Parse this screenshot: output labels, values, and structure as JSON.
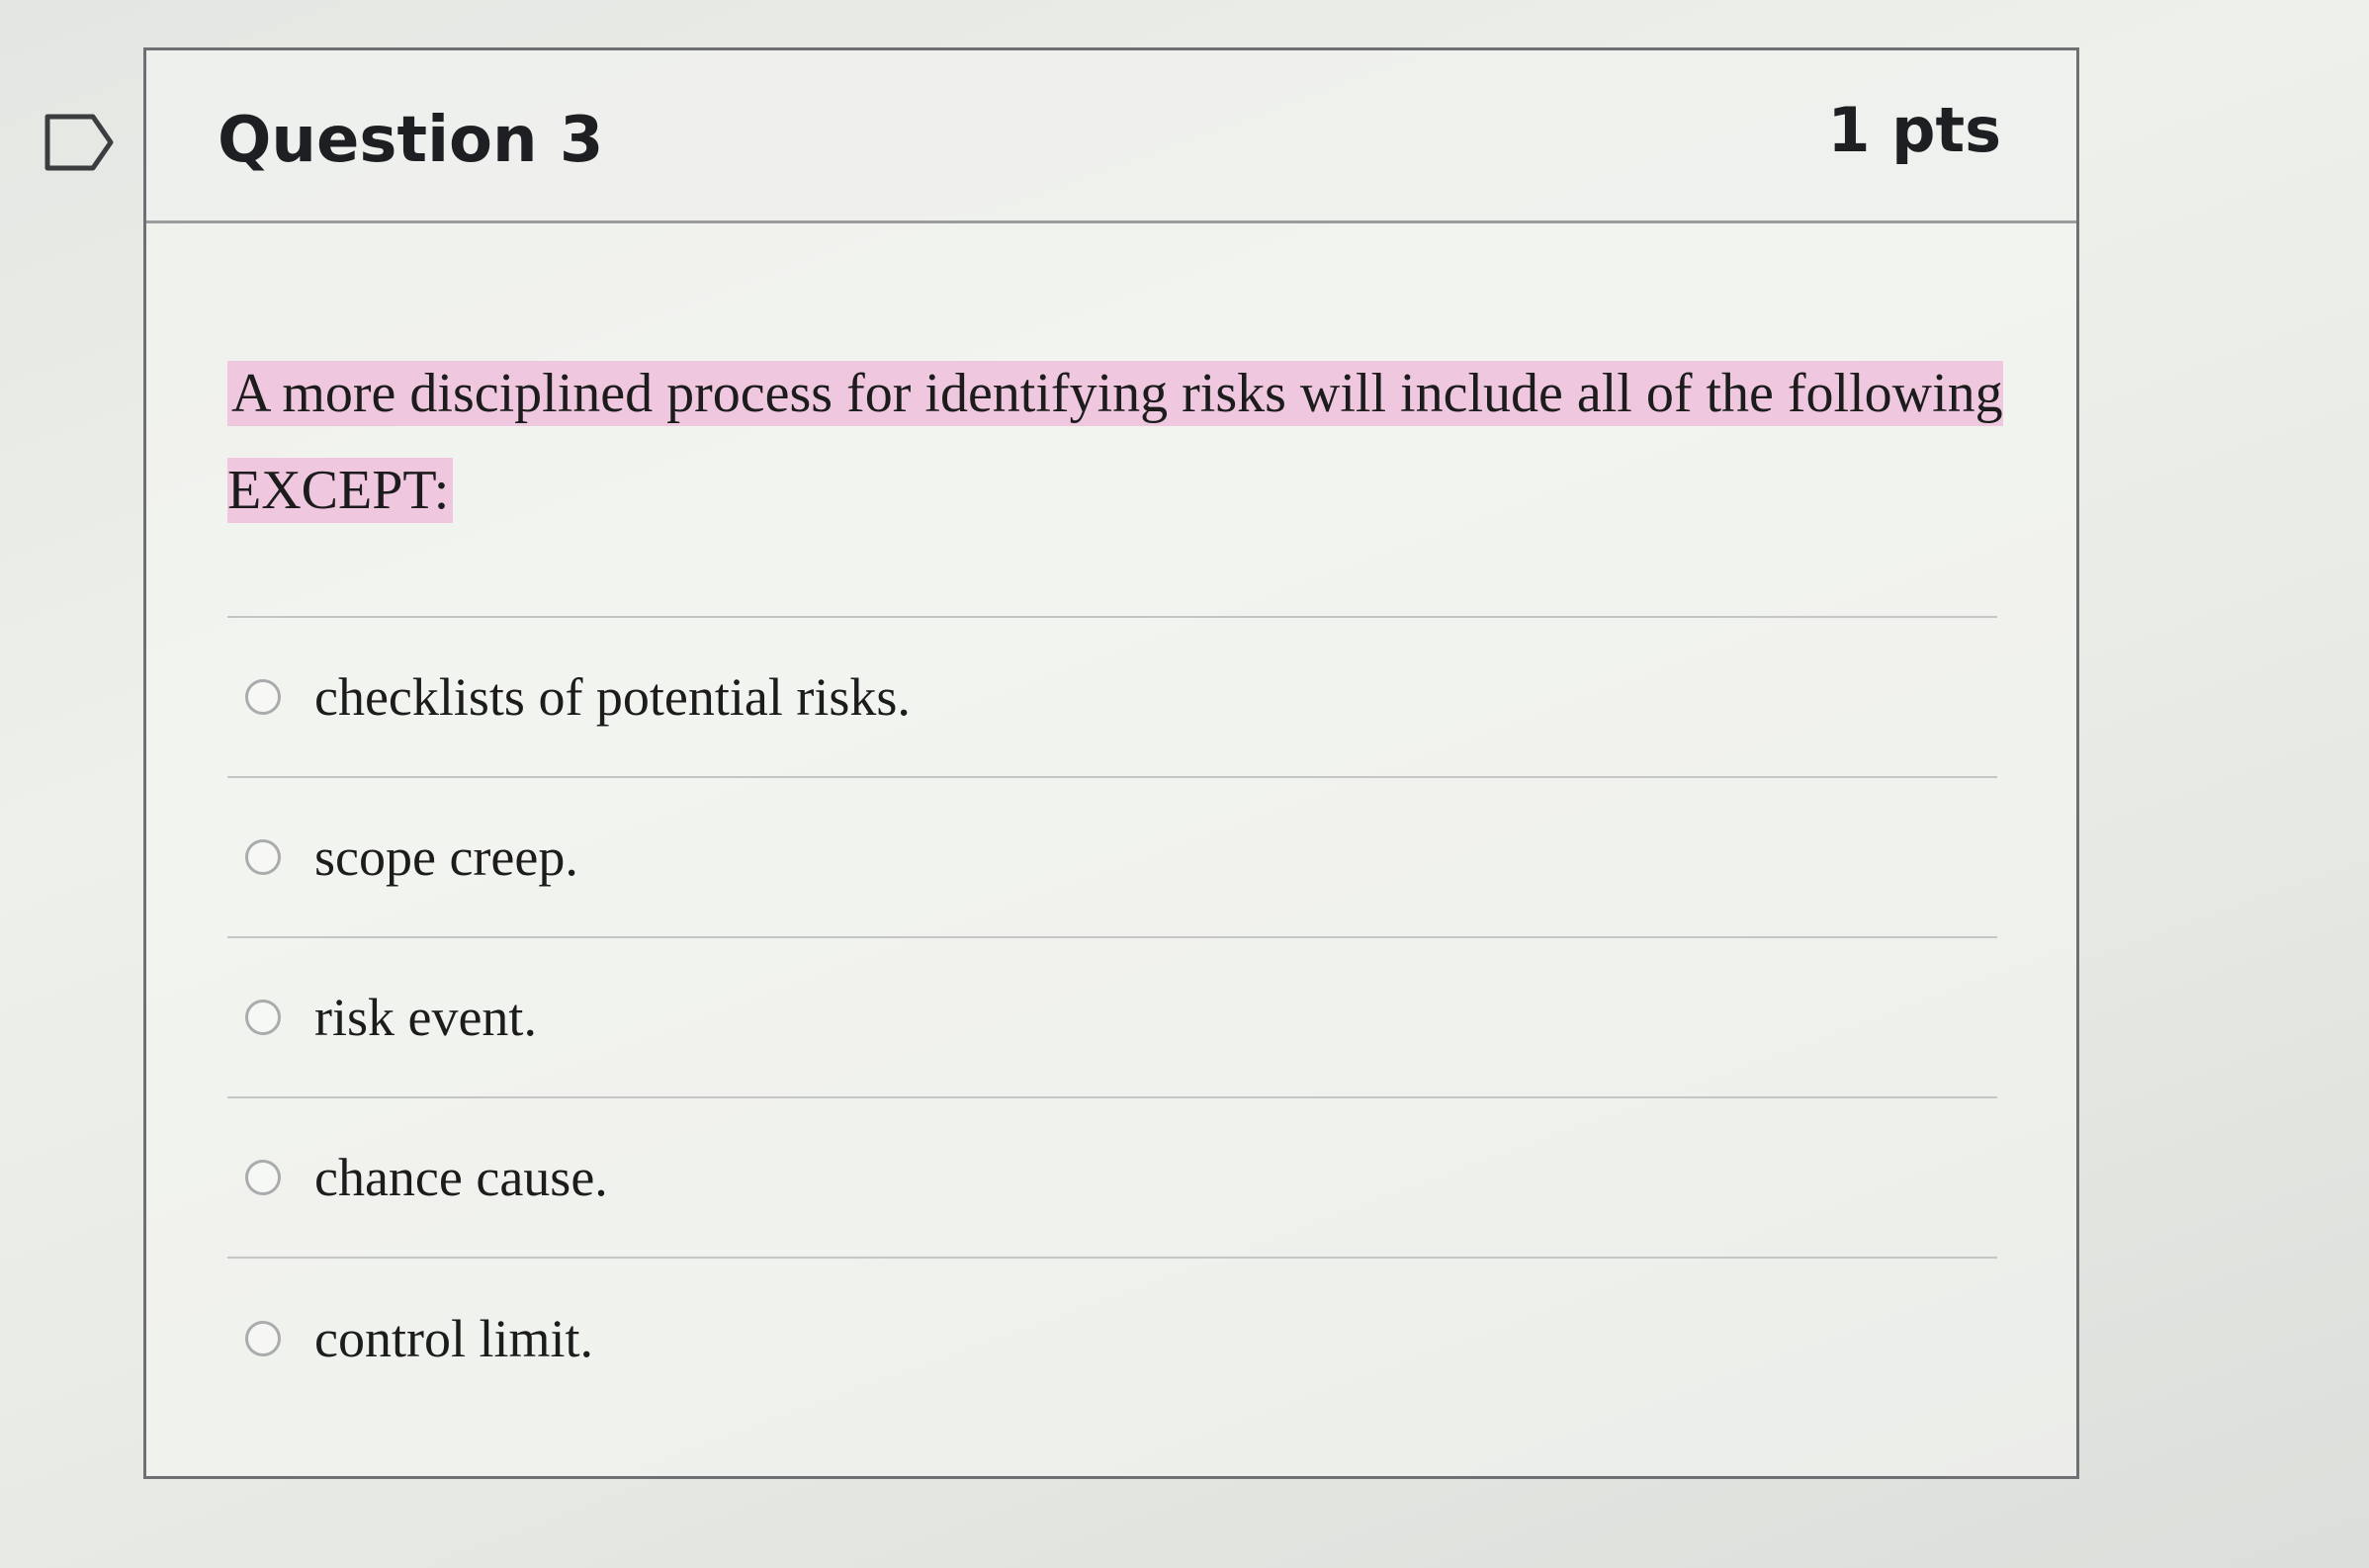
{
  "question": {
    "title": "Question 3",
    "points": "1 pts",
    "prompt": "A more disciplined process for identifying risks will include all of the following EXCEPT:",
    "highlight_color": "#efc8df",
    "flag_icon": "bookmark-flag-icon"
  },
  "answers": [
    {
      "label": "checklists of potential risks."
    },
    {
      "label": "scope creep."
    },
    {
      "label": "risk event."
    },
    {
      "label": "chance cause."
    },
    {
      "label": "control limit."
    }
  ]
}
